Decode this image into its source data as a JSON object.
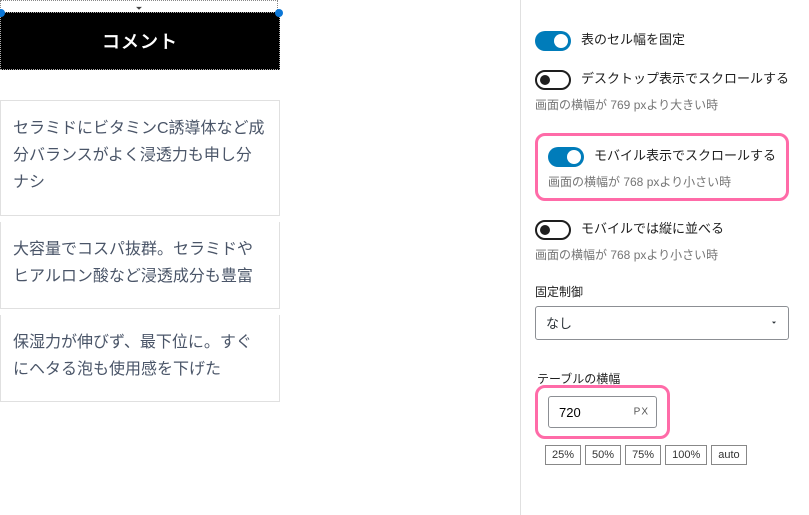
{
  "canvas": {
    "header": "コメント",
    "rows": [
      "セラミドにビタミンC誘導体など成分バランスがよく浸透力も申し分ナシ",
      "大容量でコスパ抜群。セラミドやヒアルロン酸など浸透成分も豊富",
      "保湿力が伸びず、最下位に。すぐにヘタる泡も使用感を下げた"
    ]
  },
  "sidebar": {
    "fixed_cell_width": {
      "label": "表のセル幅を固定"
    },
    "desktop_scroll": {
      "label": "デスクトップ表示でスクロールする",
      "desc": "画面の横幅が 769 pxより大きい時"
    },
    "mobile_scroll": {
      "label": "モバイル表示でスクロールする",
      "desc": "画面の横幅が 768 pxより小さい時"
    },
    "mobile_stack": {
      "label": "モバイルでは縦に並べる",
      "desc": "画面の横幅が 768 pxより小さい時"
    },
    "fixed_control": {
      "label": "固定制御",
      "value": "なし"
    },
    "table_width": {
      "label": "テーブルの横幅",
      "value": "720",
      "unit": "PX",
      "presets": [
        "25%",
        "50%",
        "75%",
        "100%",
        "auto"
      ]
    }
  }
}
